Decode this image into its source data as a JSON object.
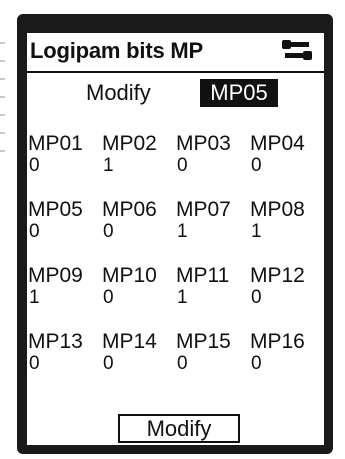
{
  "header": {
    "title": "Logipam bits MP",
    "menu_icon": "menu-icon"
  },
  "selector": {
    "label": "Modify",
    "selected": "MP05"
  },
  "bits": [
    {
      "name": "MP01",
      "value": "0"
    },
    {
      "name": "MP02",
      "value": "1"
    },
    {
      "name": "MP03",
      "value": "0"
    },
    {
      "name": "MP04",
      "value": "0"
    },
    {
      "name": "MP05",
      "value": "0"
    },
    {
      "name": "MP06",
      "value": "0"
    },
    {
      "name": "MP07",
      "value": "1"
    },
    {
      "name": "MP08",
      "value": "1"
    },
    {
      "name": "MP09",
      "value": "1"
    },
    {
      "name": "MP10",
      "value": "0"
    },
    {
      "name": "MP11",
      "value": "1"
    },
    {
      "name": "MP12",
      "value": "0"
    },
    {
      "name": "MP13",
      "value": "0"
    },
    {
      "name": "MP14",
      "value": "0"
    },
    {
      "name": "MP15",
      "value": "0"
    },
    {
      "name": "MP16",
      "value": "0"
    }
  ],
  "footer": {
    "modify_label": "Modify"
  },
  "colors": {
    "frame": "#1a1a1a",
    "screen": "#ffffff",
    "text": "#111111",
    "highlight_bg": "#111111",
    "highlight_text": "#ffffff"
  }
}
